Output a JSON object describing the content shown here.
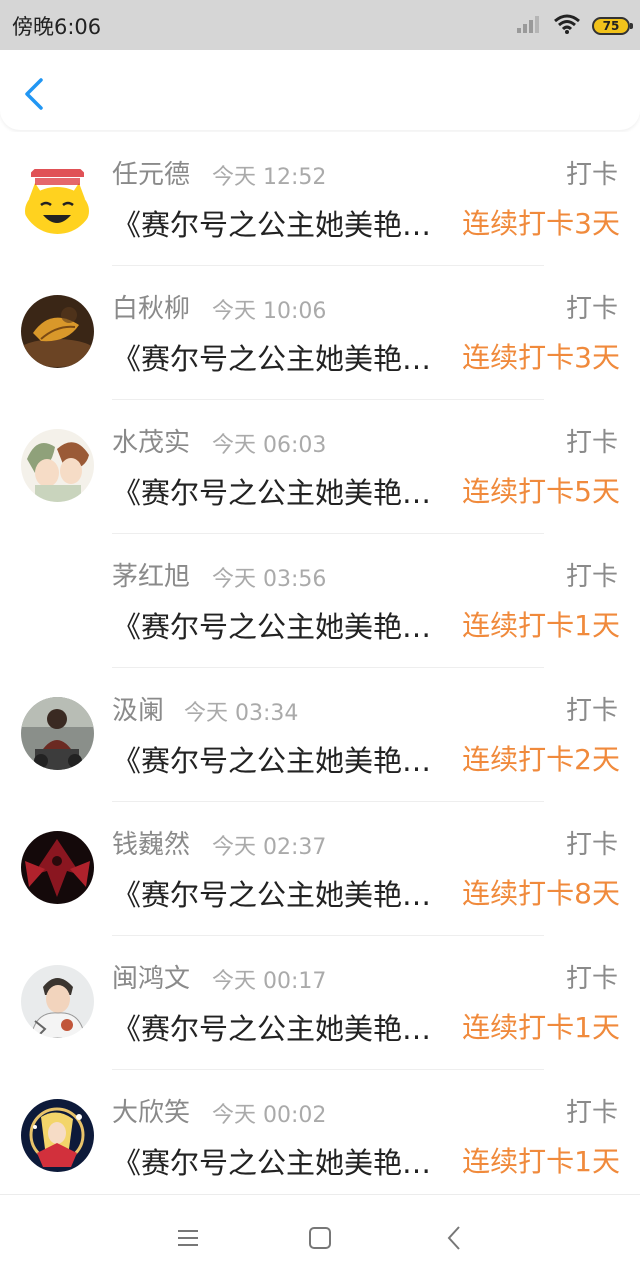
{
  "status_bar": {
    "time": "傍晚6:06",
    "battery": "75",
    "icons": [
      "signal-icon",
      "wifi-icon",
      "battery-icon"
    ]
  },
  "header": {
    "back_icon": "chevron-left-icon"
  },
  "colors": {
    "accent": "#f08a3c",
    "back": "#2196f3",
    "muted": "#8a8a8a"
  },
  "checkins": [
    {
      "name": "任元德",
      "time": "今天 12:52",
      "type": "打卡",
      "book": "《赛尔号之公主她美艳…",
      "streak": "连续打卡3天"
    },
    {
      "name": "白秋柳",
      "time": "今天 10:06",
      "type": "打卡",
      "book": "《赛尔号之公主她美艳…",
      "streak": "连续打卡3天"
    },
    {
      "name": "水茂实",
      "time": "今天 06:03",
      "type": "打卡",
      "book": "《赛尔号之公主她美艳…",
      "streak": "连续打卡5天"
    },
    {
      "name": "茅红旭",
      "time": "今天 03:56",
      "type": "打卡",
      "book": "《赛尔号之公主她美艳…",
      "streak": "连续打卡1天"
    },
    {
      "name": "汲阑",
      "time": "今天 03:34",
      "type": "打卡",
      "book": "《赛尔号之公主她美艳…",
      "streak": "连续打卡2天"
    },
    {
      "name": "钱巍然",
      "time": "今天 02:37",
      "type": "打卡",
      "book": "《赛尔号之公主她美艳…",
      "streak": "连续打卡8天"
    },
    {
      "name": "闽鸿文",
      "time": "今天 00:17",
      "type": "打卡",
      "book": "《赛尔号之公主她美艳…",
      "streak": "连续打卡1天"
    },
    {
      "name": "大欣笑",
      "time": "今天 00:02",
      "type": "打卡",
      "book": "《赛尔号之公主她美艳…",
      "streak": "连续打卡1天"
    }
  ],
  "nav_bar": {
    "icons": [
      "menu-icon",
      "home-icon",
      "back-icon"
    ]
  }
}
